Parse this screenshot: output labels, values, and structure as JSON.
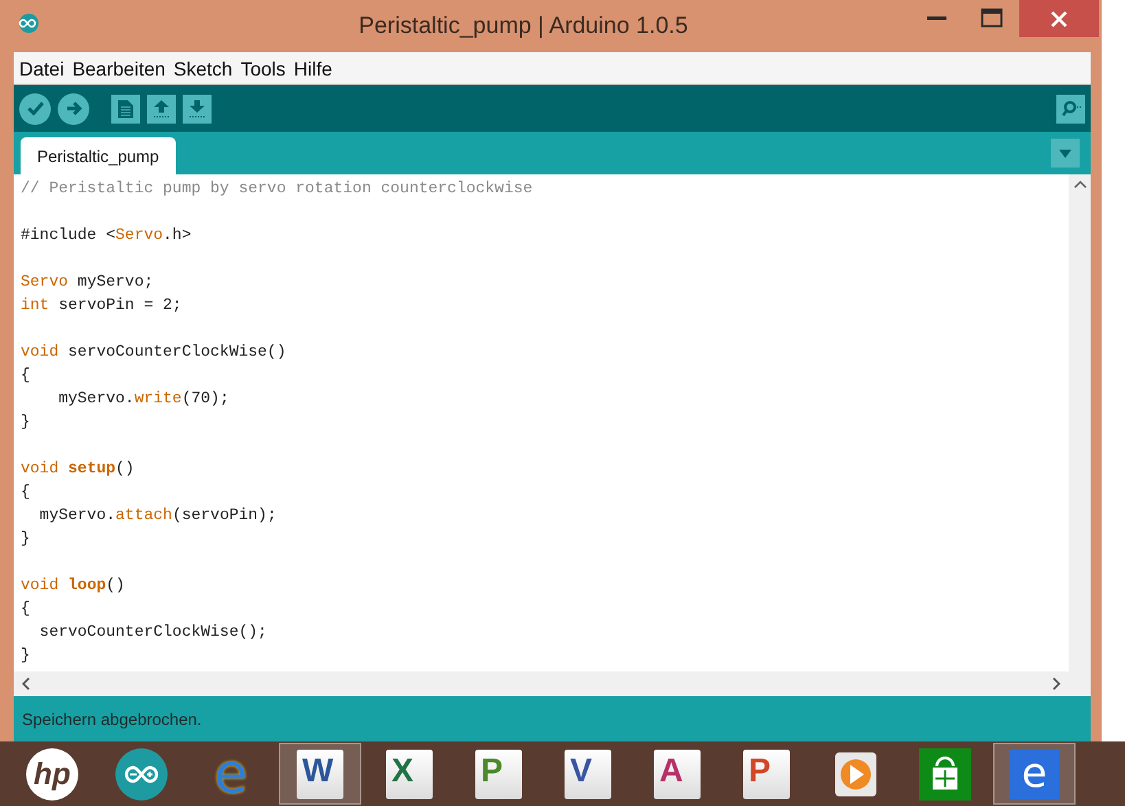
{
  "window": {
    "title": "Peristaltic_pump | Arduino 1.0.5"
  },
  "menu": [
    "Datei",
    "Bearbeiten",
    "Sketch",
    "Tools",
    "Hilfe"
  ],
  "tabs": [
    {
      "label": "Peristaltic_pump",
      "selected": true
    }
  ],
  "editor": {
    "lines": [
      {
        "kind": "code",
        "segments": [
          {
            "text": "// Peristaltic pump by servo rotation counterclockwise",
            "kind": "comment"
          }
        ]
      },
      {
        "kind": "blank"
      },
      {
        "kind": "code",
        "segments": [
          {
            "text": "#include <",
            "kind": "plain"
          },
          {
            "text": "Servo",
            "kind": "keyword"
          },
          {
            "text": ".h>",
            "kind": "plain"
          }
        ]
      },
      {
        "kind": "blank"
      },
      {
        "kind": "code",
        "segments": [
          {
            "text": "Servo",
            "kind": "keyword"
          },
          {
            "text": " myServo;",
            "kind": "plain"
          }
        ]
      },
      {
        "kind": "code",
        "segments": [
          {
            "text": "int",
            "kind": "keyword"
          },
          {
            "text": " servoPin = 2;",
            "kind": "plain"
          }
        ]
      },
      {
        "kind": "blank"
      },
      {
        "kind": "code",
        "segments": [
          {
            "text": "void",
            "kind": "keyword"
          },
          {
            "text": " servoCounterClockWise()",
            "kind": "plain"
          }
        ]
      },
      {
        "kind": "code",
        "segments": [
          {
            "text": "{",
            "kind": "plain"
          }
        ]
      },
      {
        "kind": "code",
        "segments": [
          {
            "text": "    myServo.",
            "kind": "plain"
          },
          {
            "text": "write",
            "kind": "keyword"
          },
          {
            "text": "(70);",
            "kind": "plain"
          }
        ]
      },
      {
        "kind": "code",
        "segments": [
          {
            "text": "}",
            "kind": "plain"
          }
        ]
      },
      {
        "kind": "blank"
      },
      {
        "kind": "code",
        "segments": [
          {
            "text": "void ",
            "kind": "keyword"
          },
          {
            "text": "setup",
            "kind": "function"
          },
          {
            "text": "()",
            "kind": "plain"
          }
        ]
      },
      {
        "kind": "code",
        "segments": [
          {
            "text": "{",
            "kind": "plain"
          }
        ]
      },
      {
        "kind": "code",
        "segments": [
          {
            "text": "  myServo.",
            "kind": "plain"
          },
          {
            "text": "attach",
            "kind": "keyword"
          },
          {
            "text": "(servoPin);",
            "kind": "plain"
          }
        ]
      },
      {
        "kind": "code",
        "segments": [
          {
            "text": "}",
            "kind": "plain"
          }
        ]
      },
      {
        "kind": "blank"
      },
      {
        "kind": "code",
        "segments": [
          {
            "text": "void ",
            "kind": "keyword"
          },
          {
            "text": "loop",
            "kind": "function"
          },
          {
            "text": "()",
            "kind": "plain"
          }
        ]
      },
      {
        "kind": "code",
        "segments": [
          {
            "text": "{",
            "kind": "plain"
          }
        ]
      },
      {
        "kind": "code",
        "segments": [
          {
            "text": "  servoCounterClockWise();",
            "kind": "plain"
          }
        ]
      },
      {
        "kind": "code",
        "segments": [
          {
            "text": "}",
            "kind": "plain"
          }
        ]
      }
    ]
  },
  "status_bar": {
    "message": "Speichern abgebrochen."
  },
  "taskbar": [
    {
      "kind": "hp",
      "glyph": "hp",
      "selected": false
    },
    {
      "kind": "arduino",
      "selected": false
    },
    {
      "kind": "browser",
      "glyph": "e",
      "selected": false
    },
    {
      "kind": "office",
      "glyph": "W",
      "color": "#2b579a",
      "selected": true
    },
    {
      "kind": "office",
      "glyph": "X",
      "color": "#217346",
      "selected": false
    },
    {
      "kind": "office",
      "glyph": "P",
      "color": "#4a8a2a",
      "selected": false
    },
    {
      "kind": "office",
      "glyph": "V",
      "color": "#3955a3",
      "selected": false
    },
    {
      "kind": "office",
      "glyph": "A",
      "color": "#b8306a",
      "selected": false
    },
    {
      "kind": "office",
      "glyph": "P",
      "color": "#d24726",
      "selected": false
    },
    {
      "kind": "media",
      "selected": false
    },
    {
      "kind": "store",
      "selected": false
    },
    {
      "kind": "browser-tile",
      "glyph": "e",
      "selected": true
    }
  ]
}
